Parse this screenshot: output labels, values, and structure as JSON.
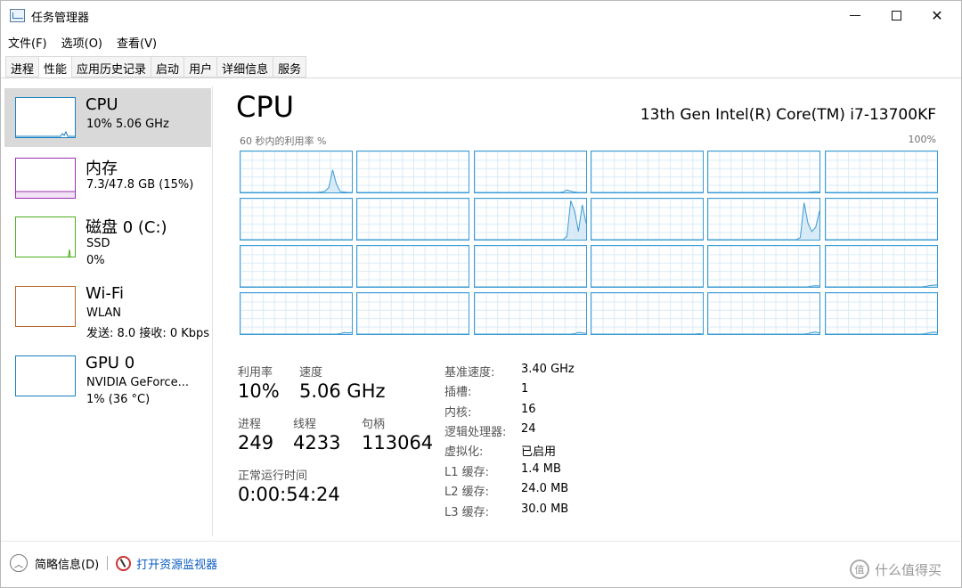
{
  "window": {
    "title": "任务管理器"
  },
  "menu": [
    "文件(F)",
    "选项(O)",
    "查看(V)"
  ],
  "tabs": [
    "进程",
    "性能",
    "应用历史记录",
    "启动",
    "用户",
    "详细信息",
    "服务"
  ],
  "active_tab": "性能",
  "sidebar": [
    {
      "title": "CPU",
      "line1": "10% 5.06 GHz",
      "line2": "",
      "color": "#1a7fbf",
      "selected": true
    },
    {
      "title": "内存",
      "line1": "7.3/47.8 GB (15%)",
      "line2": "",
      "color": "#9b2fae",
      "selected": false
    },
    {
      "title": "磁盘 0 (C:)",
      "line1": "SSD",
      "line2": "0%",
      "color": "#4caf1f",
      "selected": false
    },
    {
      "title": "Wi-Fi",
      "line1": "WLAN",
      "line2": "发送: 8.0  接收: 0 Kbps",
      "color": "#b8642a",
      "selected": false
    },
    {
      "title": "GPU 0",
      "line1": "NVIDIA GeForce...",
      "line2": "1% (36 °C)",
      "color": "#1a7fbf",
      "selected": false
    }
  ],
  "main": {
    "title": "CPU",
    "cpu_name": "13th Gen Intel(R) Core(TM) i7-13700KF",
    "graph_label": "60 秒内的利用率 %",
    "graph_max": "100%",
    "accent": "#3b9bd4"
  },
  "stats": {
    "util_label": "利用率",
    "util_value": "10%",
    "speed_label": "速度",
    "speed_value": "5.06 GHz",
    "proc_label": "进程",
    "proc_value": "249",
    "thread_label": "线程",
    "thread_value": "4233",
    "handle_label": "句柄",
    "handle_value": "113064",
    "uptime_label": "正常运行时间",
    "uptime_value": "0:00:54:24"
  },
  "details": [
    {
      "k": "基准速度:",
      "v": "3.40 GHz"
    },
    {
      "k": "插槽:",
      "v": "1"
    },
    {
      "k": "内核:",
      "v": "16"
    },
    {
      "k": "逻辑处理器:",
      "v": "24"
    },
    {
      "k": "虚拟化:",
      "v": "已启用"
    },
    {
      "k": "L1 缓存:",
      "v": "1.4 MB"
    },
    {
      "k": "L2 缓存:",
      "v": "24.0 MB"
    },
    {
      "k": "L3 缓存:",
      "v": "30.0 MB"
    }
  ],
  "core_graphs": [
    [
      0,
      0,
      0,
      0,
      0,
      0,
      0,
      0,
      0,
      0,
      0,
      0,
      0,
      0,
      0,
      0,
      0,
      0,
      0,
      0,
      0,
      1,
      3,
      12,
      55,
      20,
      2,
      1,
      0,
      0
    ],
    [
      0,
      0,
      0,
      0,
      0,
      0,
      0,
      0,
      0,
      0,
      0,
      0,
      0,
      0,
      0,
      0,
      0,
      0,
      0,
      0,
      0,
      0,
      0,
      0,
      0,
      0,
      0,
      0,
      0,
      0
    ],
    [
      0,
      0,
      0,
      0,
      0,
      0,
      0,
      0,
      0,
      0,
      0,
      0,
      0,
      0,
      0,
      0,
      0,
      0,
      0,
      0,
      0,
      0,
      0,
      1,
      6,
      3,
      1,
      0,
      0,
      0
    ],
    [
      0,
      0,
      0,
      0,
      0,
      0,
      0,
      0,
      0,
      0,
      0,
      0,
      0,
      0,
      0,
      0,
      0,
      0,
      0,
      0,
      0,
      0,
      0,
      0,
      0,
      0,
      0,
      0,
      0,
      0
    ],
    [
      0,
      0,
      0,
      0,
      0,
      0,
      0,
      0,
      0,
      0,
      0,
      0,
      0,
      0,
      0,
      0,
      0,
      0,
      0,
      0,
      0,
      0,
      0,
      0,
      0,
      0,
      0,
      1,
      2,
      1
    ],
    [
      0,
      0,
      0,
      0,
      0,
      0,
      0,
      0,
      0,
      0,
      0,
      0,
      0,
      0,
      0,
      0,
      0,
      0,
      0,
      0,
      0,
      0,
      0,
      0,
      0,
      0,
      0,
      0,
      0,
      0
    ],
    [
      0,
      0,
      0,
      0,
      0,
      0,
      0,
      0,
      0,
      0,
      0,
      0,
      0,
      0,
      0,
      0,
      0,
      0,
      0,
      0,
      0,
      0,
      0,
      0,
      0,
      0,
      0,
      0,
      0,
      0
    ],
    [
      0,
      0,
      0,
      0,
      0,
      0,
      0,
      0,
      0,
      0,
      0,
      0,
      0,
      0,
      0,
      0,
      0,
      0,
      0,
      0,
      0,
      0,
      0,
      0,
      0,
      0,
      0,
      0,
      0,
      0
    ],
    [
      0,
      0,
      0,
      0,
      0,
      0,
      0,
      0,
      0,
      0,
      0,
      0,
      0,
      0,
      0,
      0,
      0,
      0,
      0,
      0,
      0,
      0,
      0,
      0,
      8,
      95,
      70,
      20,
      85,
      40
    ],
    [
      0,
      0,
      0,
      0,
      0,
      0,
      0,
      0,
      0,
      0,
      0,
      0,
      0,
      0,
      0,
      0,
      0,
      0,
      0,
      0,
      0,
      0,
      0,
      0,
      0,
      0,
      0,
      0,
      0,
      0
    ],
    [
      0,
      0,
      0,
      0,
      0,
      0,
      0,
      0,
      0,
      0,
      0,
      0,
      0,
      0,
      0,
      0,
      0,
      0,
      0,
      0,
      0,
      0,
      0,
      0,
      5,
      90,
      40,
      20,
      30,
      70
    ],
    [
      0,
      0,
      0,
      0,
      0,
      0,
      0,
      0,
      0,
      0,
      0,
      0,
      0,
      0,
      0,
      0,
      0,
      0,
      0,
      0,
      0,
      0,
      0,
      0,
      0,
      0,
      0,
      0,
      0,
      0
    ],
    [
      0,
      0,
      0,
      0,
      0,
      0,
      0,
      0,
      0,
      0,
      0,
      0,
      0,
      0,
      0,
      0,
      0,
      0,
      0,
      0,
      0,
      0,
      0,
      0,
      0,
      0,
      0,
      0,
      0,
      0
    ],
    [
      0,
      0,
      0,
      0,
      0,
      0,
      0,
      0,
      0,
      0,
      0,
      0,
      0,
      0,
      0,
      0,
      0,
      0,
      0,
      0,
      0,
      0,
      0,
      0,
      0,
      0,
      0,
      0,
      0,
      0
    ],
    [
      0,
      0,
      0,
      0,
      0,
      0,
      0,
      0,
      0,
      0,
      0,
      0,
      0,
      0,
      0,
      0,
      0,
      0,
      0,
      0,
      0,
      0,
      0,
      0,
      0,
      0,
      0,
      0,
      0,
      0
    ],
    [
      0,
      0,
      0,
      0,
      0,
      0,
      0,
      0,
      0,
      0,
      0,
      0,
      0,
      0,
      0,
      0,
      0,
      0,
      0,
      0,
      0,
      0,
      0,
      0,
      0,
      0,
      0,
      0,
      0,
      0
    ],
    [
      0,
      0,
      0,
      0,
      0,
      0,
      0,
      0,
      0,
      0,
      0,
      0,
      0,
      0,
      0,
      0,
      0,
      0,
      0,
      0,
      0,
      0,
      0,
      0,
      0,
      0,
      0,
      2,
      3,
      2
    ],
    [
      0,
      0,
      0,
      0,
      0,
      0,
      0,
      0,
      0,
      0,
      0,
      0,
      0,
      0,
      0,
      0,
      0,
      0,
      0,
      0,
      0,
      0,
      0,
      0,
      0,
      0,
      1,
      3,
      4,
      5
    ],
    [
      0,
      0,
      0,
      0,
      0,
      0,
      0,
      0,
      0,
      0,
      0,
      0,
      0,
      0,
      0,
      0,
      0,
      0,
      0,
      0,
      0,
      0,
      0,
      0,
      0,
      0,
      1,
      4,
      3,
      4
    ],
    [
      0,
      0,
      0,
      0,
      0,
      0,
      0,
      0,
      0,
      0,
      0,
      0,
      0,
      0,
      0,
      0,
      0,
      0,
      0,
      0,
      0,
      0,
      0,
      0,
      0,
      0,
      0,
      0,
      0,
      0
    ],
    [
      0,
      0,
      0,
      0,
      0,
      0,
      0,
      0,
      0,
      0,
      0,
      0,
      0,
      0,
      0,
      0,
      0,
      0,
      0,
      0,
      0,
      0,
      0,
      0,
      0,
      0,
      1,
      4,
      3,
      2
    ],
    [
      0,
      0,
      0,
      0,
      0,
      0,
      0,
      0,
      0,
      0,
      0,
      0,
      0,
      0,
      0,
      0,
      0,
      0,
      0,
      0,
      0,
      0,
      0,
      0,
      0,
      0,
      0,
      0,
      1,
      0
    ],
    [
      0,
      0,
      0,
      0,
      0,
      0,
      0,
      0,
      0,
      0,
      0,
      0,
      0,
      0,
      0,
      0,
      0,
      0,
      0,
      0,
      0,
      0,
      0,
      0,
      0,
      0,
      1,
      4,
      5,
      3
    ],
    [
      0,
      0,
      0,
      0,
      0,
      0,
      0,
      0,
      0,
      0,
      0,
      0,
      0,
      0,
      0,
      0,
      0,
      0,
      0,
      0,
      0,
      0,
      0,
      0,
      0,
      0,
      1,
      3,
      5,
      4
    ]
  ],
  "footer": {
    "less_details": "简略信息(D)",
    "resource_monitor": "打开资源监视器"
  },
  "watermark": "什么值得买"
}
